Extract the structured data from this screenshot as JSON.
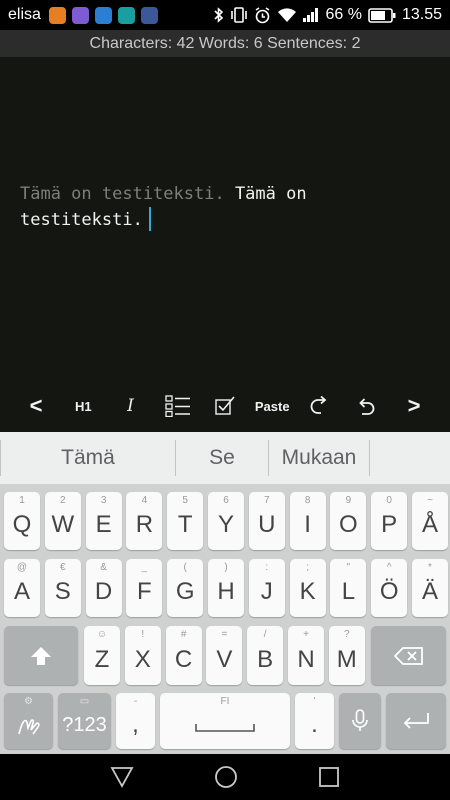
{
  "status_bar": {
    "carrier": "elisa",
    "app_icons": [
      "maps-icon",
      "viber-icon",
      "viber-icon",
      "messenger-icon",
      "facebook-icon"
    ],
    "battery": "66 %",
    "time": "13.55"
  },
  "stats": {
    "text": "Characters: 42 Words: 6 Sentences: 2"
  },
  "editor": {
    "line1_muted": "Tämä on testiteksti.",
    "line1_rest": " Tämä on",
    "line2": "testiteksti."
  },
  "toolbar": {
    "prev": "<",
    "h1": "H1",
    "italic": "I",
    "paste": "Paste",
    "next": ">"
  },
  "suggestions": [
    "Tämä",
    "Se",
    "Mukaan"
  ],
  "keyboard": {
    "row1": [
      {
        "k": "Q",
        "h": "1"
      },
      {
        "k": "W",
        "h": "2"
      },
      {
        "k": "E",
        "h": "3"
      },
      {
        "k": "R",
        "h": "4"
      },
      {
        "k": "T",
        "h": "5"
      },
      {
        "k": "Y",
        "h": "6"
      },
      {
        "k": "U",
        "h": "7"
      },
      {
        "k": "I",
        "h": "8"
      },
      {
        "k": "O",
        "h": "9"
      },
      {
        "k": "P",
        "h": "0"
      },
      {
        "k": "Å",
        "h": "~"
      }
    ],
    "row2": [
      {
        "k": "A",
        "h": "@"
      },
      {
        "k": "S",
        "h": "€"
      },
      {
        "k": "D",
        "h": "&"
      },
      {
        "k": "F",
        "h": "_"
      },
      {
        "k": "G",
        "h": "("
      },
      {
        "k": "H",
        "h": ")"
      },
      {
        "k": "J",
        "h": ":"
      },
      {
        "k": "K",
        "h": ";"
      },
      {
        "k": "L",
        "h": "\""
      },
      {
        "k": "Ö",
        "h": "^"
      },
      {
        "k": "Ä",
        "h": "*"
      }
    ],
    "row3": [
      {
        "k": "Z",
        "h": "☺"
      },
      {
        "k": "X",
        "h": "!"
      },
      {
        "k": "C",
        "h": "#"
      },
      {
        "k": "V",
        "h": "="
      },
      {
        "k": "B",
        "h": "/"
      },
      {
        "k": "N",
        "h": "+"
      },
      {
        "k": "M",
        "h": "?"
      }
    ],
    "symbols_label": "?123",
    "comma": ",",
    "comma_hint": "-",
    "space_hint": "FI",
    "period": ".",
    "period_hint": "'"
  }
}
